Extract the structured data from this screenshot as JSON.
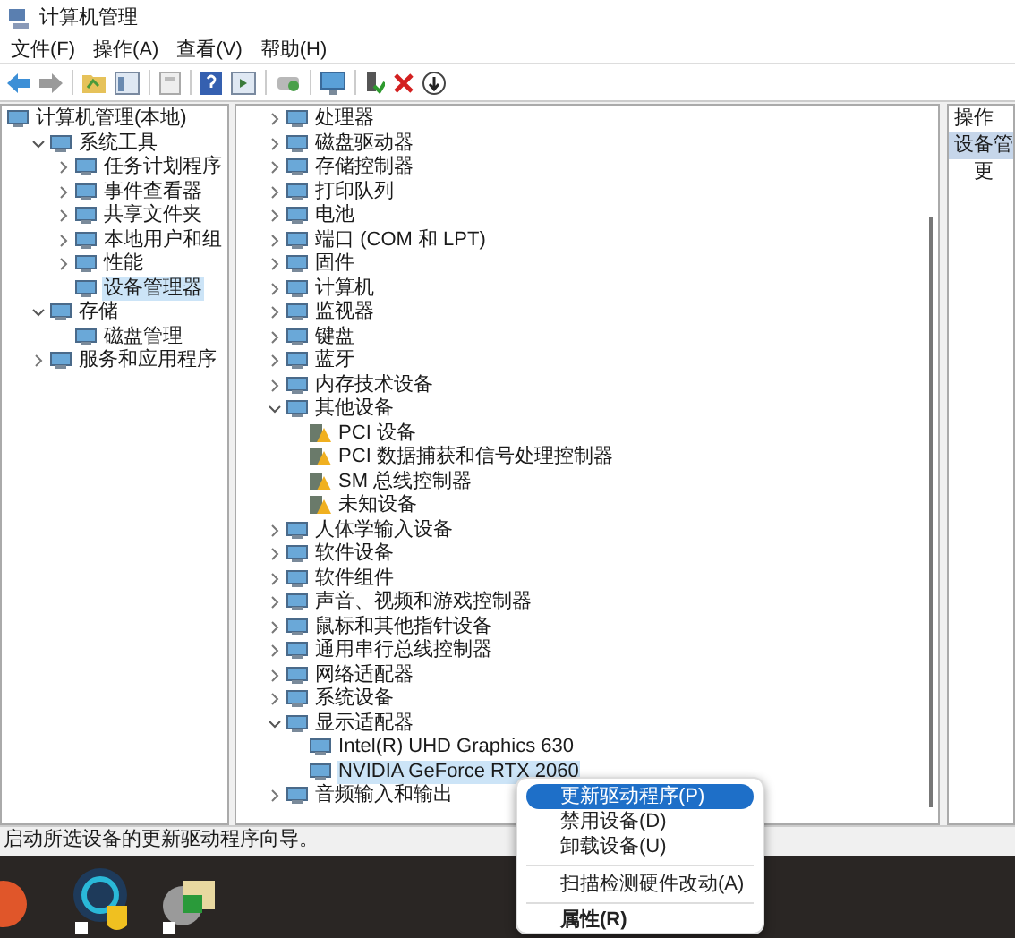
{
  "window": {
    "title": "计算机管理"
  },
  "menu_bar": [
    "文件(F)",
    "操作(A)",
    "查看(V)",
    "帮助(H)"
  ],
  "nav_tree": [
    {
      "label": "计算机管理(本地)",
      "selected": false,
      "children": [
        {
          "label": "系统工具",
          "expanded": true,
          "selected": false,
          "children": [
            {
              "label": "任务计划程序",
              "expanded": false,
              "selected": false
            },
            {
              "label": "事件查看器",
              "expanded": false,
              "selected": false
            },
            {
              "label": "共享文件夹",
              "expanded": false,
              "selected": false
            },
            {
              "label": "本地用户和组",
              "expanded": false,
              "selected": false
            },
            {
              "label": "性能",
              "expanded": false,
              "selected": false
            },
            {
              "label": "设备管理器",
              "selected": true
            }
          ]
        },
        {
          "label": "存储",
          "expanded": true,
          "selected": false,
          "children": [
            {
              "label": "磁盘管理",
              "selected": false
            }
          ]
        },
        {
          "label": "服务和应用程序",
          "expanded": false,
          "selected": false
        }
      ]
    }
  ],
  "device_tree": [
    {
      "label": "处理器",
      "expanded": false,
      "selected": false
    },
    {
      "label": "磁盘驱动器",
      "expanded": false,
      "selected": false
    },
    {
      "label": "存储控制器",
      "expanded": false,
      "selected": false
    },
    {
      "label": "打印队列",
      "expanded": false,
      "selected": false
    },
    {
      "label": "电池",
      "expanded": false,
      "selected": false
    },
    {
      "label": "端口 (COM 和 LPT)",
      "expanded": false,
      "selected": false
    },
    {
      "label": "固件",
      "expanded": false,
      "selected": false
    },
    {
      "label": "计算机",
      "expanded": false,
      "selected": false
    },
    {
      "label": "监视器",
      "expanded": false,
      "selected": false
    },
    {
      "label": "键盘",
      "expanded": false,
      "selected": false
    },
    {
      "label": "蓝牙",
      "expanded": false,
      "selected": false
    },
    {
      "label": "内存技术设备",
      "expanded": false,
      "selected": false
    },
    {
      "label": "其他设备",
      "expanded": true,
      "selected": false,
      "children": [
        {
          "label": "PCI 设备",
          "warning": true,
          "selected": false
        },
        {
          "label": "PCI 数据捕获和信号处理控制器",
          "warning": true,
          "selected": false
        },
        {
          "label": "SM 总线控制器",
          "warning": true,
          "selected": false
        },
        {
          "label": "未知设备",
          "warning": true,
          "selected": false
        }
      ]
    },
    {
      "label": "人体学输入设备",
      "expanded": false,
      "selected": false
    },
    {
      "label": "软件设备",
      "expanded": false,
      "selected": false
    },
    {
      "label": "软件组件",
      "expanded": false,
      "selected": false
    },
    {
      "label": "声音、视频和游戏控制器",
      "expanded": false,
      "selected": false
    },
    {
      "label": "鼠标和其他指针设备",
      "expanded": false,
      "selected": false
    },
    {
      "label": "通用串行总线控制器",
      "expanded": false,
      "selected": false
    },
    {
      "label": "网络适配器",
      "expanded": false,
      "selected": false
    },
    {
      "label": "系统设备",
      "expanded": false,
      "selected": false
    },
    {
      "label": "显示适配器",
      "expanded": true,
      "selected": false,
      "children": [
        {
          "label": "Intel(R) UHD Graphics 630",
          "warning": false,
          "selected": false
        },
        {
          "label": "NVIDIA GeForce RTX 2060",
          "warning": false,
          "selected": true
        }
      ]
    },
    {
      "label": "音频输入和输出",
      "expanded": false,
      "selected": false
    }
  ],
  "actions_pane": {
    "header": "操作",
    "items": [
      {
        "label": "设备管",
        "selected": true
      },
      {
        "label": "更",
        "selected": false
      }
    ]
  },
  "context_menu": [
    {
      "kind": "item",
      "label": "更新驱动程序(P)",
      "selected": true
    },
    {
      "kind": "item",
      "label": "禁用设备(D)",
      "selected": false
    },
    {
      "kind": "item",
      "label": "卸载设备(U)",
      "selected": false
    },
    {
      "kind": "separator"
    },
    {
      "kind": "item",
      "label": "扫描检测硬件改动(A)",
      "selected": false
    },
    {
      "kind": "separator"
    },
    {
      "kind": "default",
      "label": "属性(R)",
      "selected": false
    }
  ],
  "status_bar": "启动所选设备的更新驱动程序向导。"
}
